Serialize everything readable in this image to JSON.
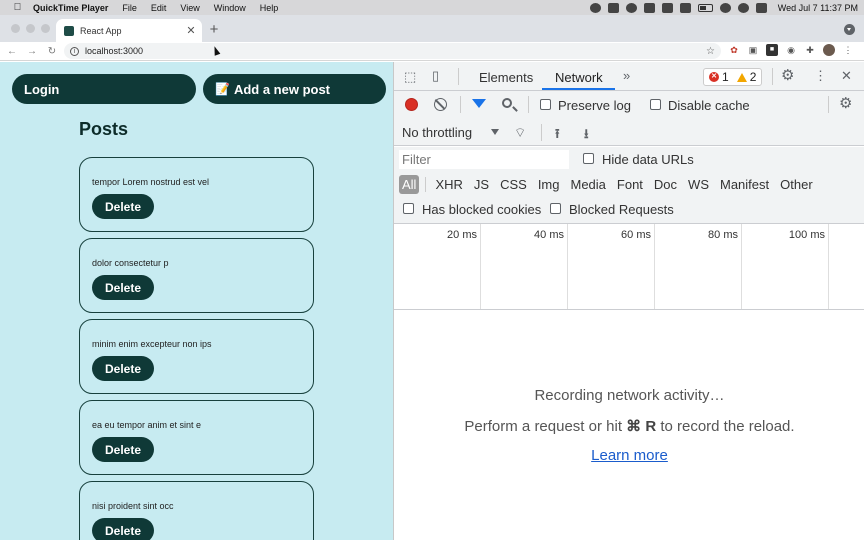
{
  "menubar": {
    "app_name": "QuickTime Player",
    "items": [
      "File",
      "Edit",
      "View",
      "Window",
      "Help"
    ],
    "clock": "Wed Jul 7  11:37 PM"
  },
  "browser": {
    "tab_title": "React App",
    "url": "localhost:3000"
  },
  "page": {
    "login_label": "Login",
    "add_post_label": "Add a new post",
    "add_post_emoji": "📝",
    "heading": "Posts",
    "posts": [
      {
        "text": "tempor Lorem nostrud est vel",
        "delete_label": "Delete"
      },
      {
        "text": "dolor consectetur p",
        "delete_label": "Delete"
      },
      {
        "text": "minim enim excepteur non ips",
        "delete_label": "Delete"
      },
      {
        "text": "ea eu tempor anim et sint e",
        "delete_label": "Delete"
      },
      {
        "text": "nisi proident sint occ",
        "delete_label": "Delete"
      }
    ]
  },
  "devtools": {
    "tabs": [
      "Elements",
      "Network"
    ],
    "active_tab": "Network",
    "error_count": "1",
    "warning_count": "2",
    "preserve_log": "Preserve log",
    "disable_cache": "Disable cache",
    "throttling": "No throttling",
    "filter_placeholder": "Filter",
    "hide_data_urls": "Hide data URLs",
    "types": [
      "All",
      "XHR",
      "JS",
      "CSS",
      "Img",
      "Media",
      "Font",
      "Doc",
      "WS",
      "Manifest",
      "Other"
    ],
    "has_blocked_cookies": "Has blocked cookies",
    "blocked_requests": "Blocked Requests",
    "timeline_labels": [
      "20 ms",
      "40 ms",
      "60 ms",
      "80 ms",
      "100 ms"
    ],
    "empty_title": "Recording network activity…",
    "empty_hint_prefix": "Perform a request or hit ",
    "empty_hint_key": "⌘ R",
    "empty_hint_suffix": " to record the reload.",
    "learn_more": "Learn more"
  },
  "colors": {
    "page_bg": "#c7ebf1",
    "button_bg": "#0f3937",
    "accent_blue": "#1a73e8",
    "record_red": "#d93025"
  }
}
